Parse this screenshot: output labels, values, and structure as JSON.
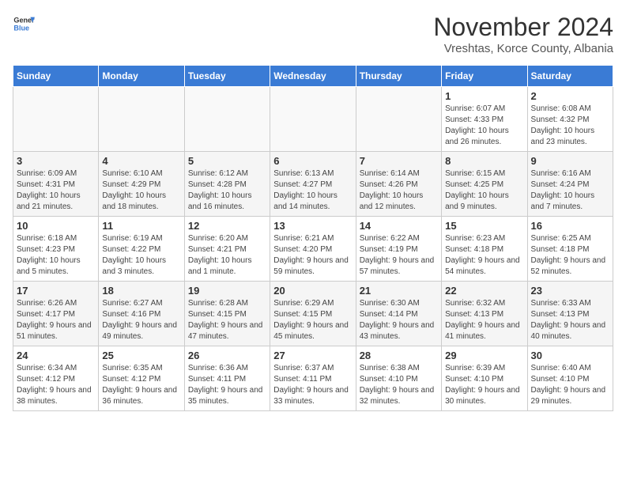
{
  "logo": {
    "general": "General",
    "blue": "Blue"
  },
  "title": {
    "month_year": "November 2024",
    "location": "Vreshtas, Korce County, Albania"
  },
  "days_of_week": [
    "Sunday",
    "Monday",
    "Tuesday",
    "Wednesday",
    "Thursday",
    "Friday",
    "Saturday"
  ],
  "weeks": [
    [
      {
        "day": "",
        "info": ""
      },
      {
        "day": "",
        "info": ""
      },
      {
        "day": "",
        "info": ""
      },
      {
        "day": "",
        "info": ""
      },
      {
        "day": "",
        "info": ""
      },
      {
        "day": "1",
        "info": "Sunrise: 6:07 AM\nSunset: 4:33 PM\nDaylight: 10 hours and 26 minutes."
      },
      {
        "day": "2",
        "info": "Sunrise: 6:08 AM\nSunset: 4:32 PM\nDaylight: 10 hours and 23 minutes."
      }
    ],
    [
      {
        "day": "3",
        "info": "Sunrise: 6:09 AM\nSunset: 4:31 PM\nDaylight: 10 hours and 21 minutes."
      },
      {
        "day": "4",
        "info": "Sunrise: 6:10 AM\nSunset: 4:29 PM\nDaylight: 10 hours and 18 minutes."
      },
      {
        "day": "5",
        "info": "Sunrise: 6:12 AM\nSunset: 4:28 PM\nDaylight: 10 hours and 16 minutes."
      },
      {
        "day": "6",
        "info": "Sunrise: 6:13 AM\nSunset: 4:27 PM\nDaylight: 10 hours and 14 minutes."
      },
      {
        "day": "7",
        "info": "Sunrise: 6:14 AM\nSunset: 4:26 PM\nDaylight: 10 hours and 12 minutes."
      },
      {
        "day": "8",
        "info": "Sunrise: 6:15 AM\nSunset: 4:25 PM\nDaylight: 10 hours and 9 minutes."
      },
      {
        "day": "9",
        "info": "Sunrise: 6:16 AM\nSunset: 4:24 PM\nDaylight: 10 hours and 7 minutes."
      }
    ],
    [
      {
        "day": "10",
        "info": "Sunrise: 6:18 AM\nSunset: 4:23 PM\nDaylight: 10 hours and 5 minutes."
      },
      {
        "day": "11",
        "info": "Sunrise: 6:19 AM\nSunset: 4:22 PM\nDaylight: 10 hours and 3 minutes."
      },
      {
        "day": "12",
        "info": "Sunrise: 6:20 AM\nSunset: 4:21 PM\nDaylight: 10 hours and 1 minute."
      },
      {
        "day": "13",
        "info": "Sunrise: 6:21 AM\nSunset: 4:20 PM\nDaylight: 9 hours and 59 minutes."
      },
      {
        "day": "14",
        "info": "Sunrise: 6:22 AM\nSunset: 4:19 PM\nDaylight: 9 hours and 57 minutes."
      },
      {
        "day": "15",
        "info": "Sunrise: 6:23 AM\nSunset: 4:18 PM\nDaylight: 9 hours and 54 minutes."
      },
      {
        "day": "16",
        "info": "Sunrise: 6:25 AM\nSunset: 4:18 PM\nDaylight: 9 hours and 52 minutes."
      }
    ],
    [
      {
        "day": "17",
        "info": "Sunrise: 6:26 AM\nSunset: 4:17 PM\nDaylight: 9 hours and 51 minutes."
      },
      {
        "day": "18",
        "info": "Sunrise: 6:27 AM\nSunset: 4:16 PM\nDaylight: 9 hours and 49 minutes."
      },
      {
        "day": "19",
        "info": "Sunrise: 6:28 AM\nSunset: 4:15 PM\nDaylight: 9 hours and 47 minutes."
      },
      {
        "day": "20",
        "info": "Sunrise: 6:29 AM\nSunset: 4:15 PM\nDaylight: 9 hours and 45 minutes."
      },
      {
        "day": "21",
        "info": "Sunrise: 6:30 AM\nSunset: 4:14 PM\nDaylight: 9 hours and 43 minutes."
      },
      {
        "day": "22",
        "info": "Sunrise: 6:32 AM\nSunset: 4:13 PM\nDaylight: 9 hours and 41 minutes."
      },
      {
        "day": "23",
        "info": "Sunrise: 6:33 AM\nSunset: 4:13 PM\nDaylight: 9 hours and 40 minutes."
      }
    ],
    [
      {
        "day": "24",
        "info": "Sunrise: 6:34 AM\nSunset: 4:12 PM\nDaylight: 9 hours and 38 minutes."
      },
      {
        "day": "25",
        "info": "Sunrise: 6:35 AM\nSunset: 4:12 PM\nDaylight: 9 hours and 36 minutes."
      },
      {
        "day": "26",
        "info": "Sunrise: 6:36 AM\nSunset: 4:11 PM\nDaylight: 9 hours and 35 minutes."
      },
      {
        "day": "27",
        "info": "Sunrise: 6:37 AM\nSunset: 4:11 PM\nDaylight: 9 hours and 33 minutes."
      },
      {
        "day": "28",
        "info": "Sunrise: 6:38 AM\nSunset: 4:10 PM\nDaylight: 9 hours and 32 minutes."
      },
      {
        "day": "29",
        "info": "Sunrise: 6:39 AM\nSunset: 4:10 PM\nDaylight: 9 hours and 30 minutes."
      },
      {
        "day": "30",
        "info": "Sunrise: 6:40 AM\nSunset: 4:10 PM\nDaylight: 9 hours and 29 minutes."
      }
    ]
  ]
}
